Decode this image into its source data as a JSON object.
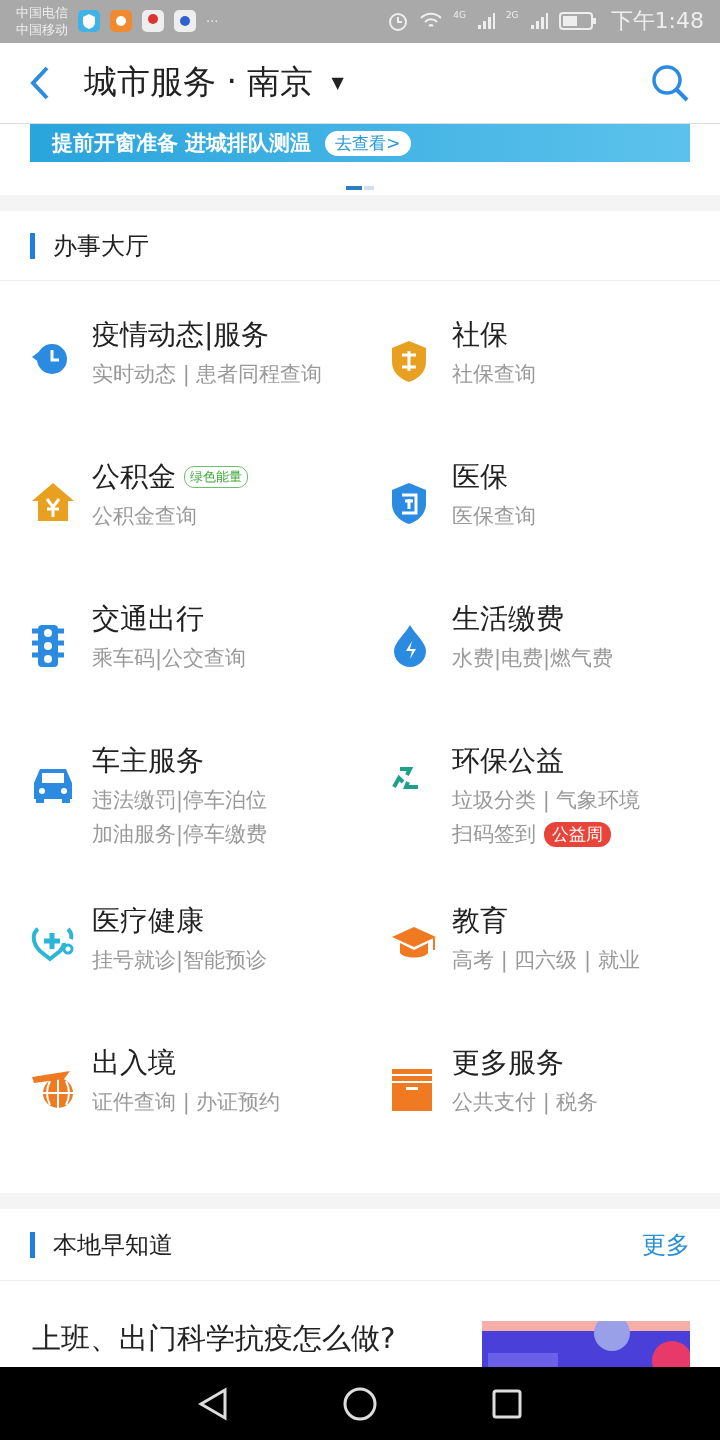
{
  "status_bar": {
    "carriers": [
      "中国电信",
      "中国移动"
    ],
    "network_labels": [
      "4G",
      "2G"
    ],
    "time": "下午1:48",
    "notification_more": "···"
  },
  "header": {
    "title": "城市服务 · 南京",
    "dropdown": "▼"
  },
  "banner": {
    "text": "提前开窗准备 进城排队测温",
    "button": "去查看>",
    "pages": [
      {
        "selected": true
      },
      {
        "selected": false
      }
    ]
  },
  "hall": {
    "title": "办事大厅",
    "services": [
      {
        "title": "疫情动态|服务",
        "lines": [
          {
            "text": "实时动态 | 患者同程查询"
          }
        ]
      },
      {
        "title": "社保",
        "lines": [
          {
            "text": "社保查询"
          }
        ]
      },
      {
        "title": "公积金",
        "tag": "绿色能量",
        "lines": [
          {
            "text": "公积金查询"
          }
        ]
      },
      {
        "title": "医保",
        "lines": [
          {
            "text": "医保查询"
          }
        ]
      },
      {
        "title": "交通出行",
        "lines": [
          {
            "text": "乘车码|公交查询"
          }
        ]
      },
      {
        "title": "生活缴费",
        "lines": [
          {
            "text": "水费|电费|燃气费"
          }
        ]
      },
      {
        "title": "车主服务",
        "lines": [
          {
            "text": "违法缴罚|停车泊位"
          },
          {
            "text": "加油服务|停车缴费"
          }
        ]
      },
      {
        "title": "环保公益",
        "lines": [
          {
            "text": "垃圾分类 | 气象环境"
          },
          {
            "text": "扫码签到",
            "badge": "公益周"
          }
        ]
      },
      {
        "title": "医疗健康",
        "lines": [
          {
            "text": "挂号就诊|智能预诊"
          }
        ]
      },
      {
        "title": "教育",
        "lines": [
          {
            "text": "高考 | 四六级 | 就业"
          }
        ]
      },
      {
        "title": "出入境",
        "lines": [
          {
            "text": "证件查询 | 办证预约"
          }
        ]
      },
      {
        "title": "更多服务",
        "lines": [
          {
            "text": "公共支付 | 税务"
          }
        ]
      }
    ]
  },
  "local": {
    "title": "本地早知道",
    "more": "更多",
    "article": {
      "title": "上班、出门科学抗疫怎么做?"
    }
  }
}
